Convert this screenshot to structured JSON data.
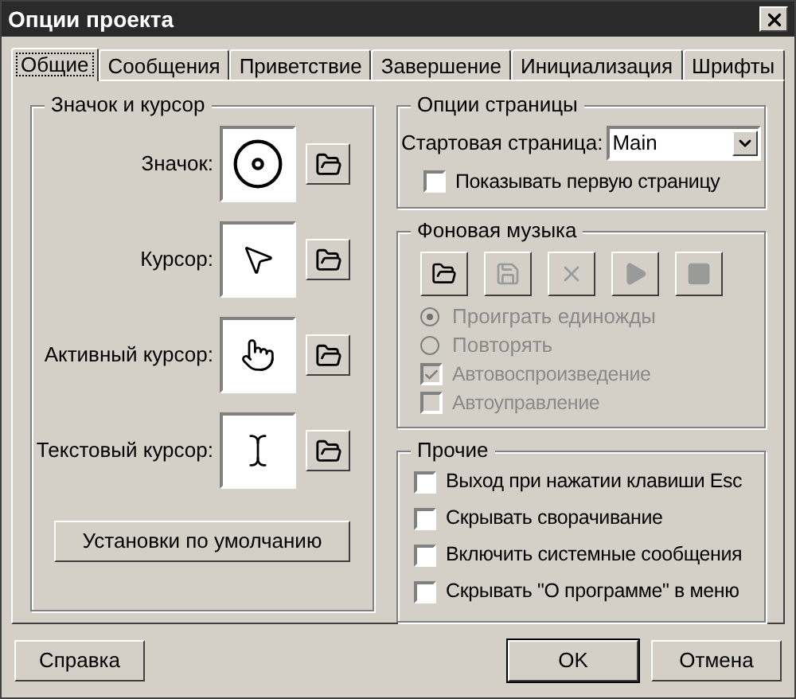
{
  "window": {
    "title": "Опции проекта"
  },
  "tabs": [
    {
      "label": "Общие",
      "selected": true
    },
    {
      "label": "Сообщения",
      "selected": false
    },
    {
      "label": "Приветствие",
      "selected": false
    },
    {
      "label": "Завершение",
      "selected": false
    },
    {
      "label": "Инициализация",
      "selected": false
    },
    {
      "label": "Шрифты",
      "selected": false
    }
  ],
  "icon_cursor": {
    "title": "Значок и курсор",
    "rows": [
      {
        "label": "Значок:",
        "kind": "disc"
      },
      {
        "label": "Курсор:",
        "kind": "arrow"
      },
      {
        "label": "Активный курсор:",
        "kind": "hand"
      },
      {
        "label": "Текстовый курсор:",
        "kind": "ibeam"
      }
    ],
    "default_button": "Установки по умолчанию"
  },
  "page_options": {
    "title": "Опции страницы",
    "start_page_label": "Стартовая страница:",
    "start_page_value": "Main",
    "show_first_page": {
      "label": "Показывать первую страницу",
      "checked": false
    }
  },
  "music": {
    "title": "Фоновая музыка",
    "buttons": [
      {
        "kind": "open",
        "disabled": false
      },
      {
        "kind": "save",
        "disabled": true
      },
      {
        "kind": "delete",
        "disabled": true
      },
      {
        "kind": "play",
        "disabled": true
      },
      {
        "kind": "stop",
        "disabled": true
      }
    ],
    "radios": [
      {
        "label": "Проиграть единожды",
        "selected": true,
        "disabled": true
      },
      {
        "label": "Повторять",
        "selected": false,
        "disabled": true
      }
    ],
    "checkboxes": [
      {
        "label": "Автовоспроизведение",
        "checked": true,
        "disabled": true
      },
      {
        "label": "Автоуправление",
        "checked": false,
        "disabled": true
      }
    ]
  },
  "other": {
    "title": "Прочие",
    "checkboxes": [
      {
        "label": "Выход при нажатии клавиши Esc",
        "checked": false
      },
      {
        "label": "Скрывать сворачивание",
        "checked": false
      },
      {
        "label": "Включить системные сообщения",
        "checked": false
      },
      {
        "label": "Скрывать \"О программе\" в меню",
        "checked": false
      }
    ]
  },
  "footer": {
    "help": "Справка",
    "ok": "OK",
    "cancel": "Отмена"
  }
}
